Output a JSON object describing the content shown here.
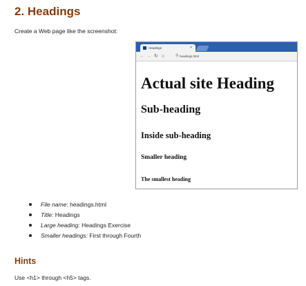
{
  "section_title": "2. Headings",
  "intro": "Create a Web page like the screenshot:",
  "browser": {
    "tab_title": "Headings",
    "tab_close": "×",
    "address": "headings.html",
    "headings": {
      "h1": "Actual site Heading",
      "h2": "Sub-heading",
      "h3": "Inside sub-heading",
      "h4": "Smaller heading",
      "h5": "The smallest heading"
    }
  },
  "bullets": [
    {
      "key": "File name",
      "sep": ":",
      "value": " headings.html"
    },
    {
      "key": "Title:",
      "sep": "",
      "value": " Headings"
    },
    {
      "key": "Large heading:",
      "sep": "",
      "value": " Headings Exercise"
    },
    {
      "key": "Smaller headings:",
      "sep": "",
      "value": " First through Fourth"
    }
  ],
  "hints_title": "Hints",
  "hints_text": "Use <h1> through <h5> tags.",
  "colors": {
    "heading": "#843c0c",
    "browser_frame": "#2b5fb3"
  }
}
